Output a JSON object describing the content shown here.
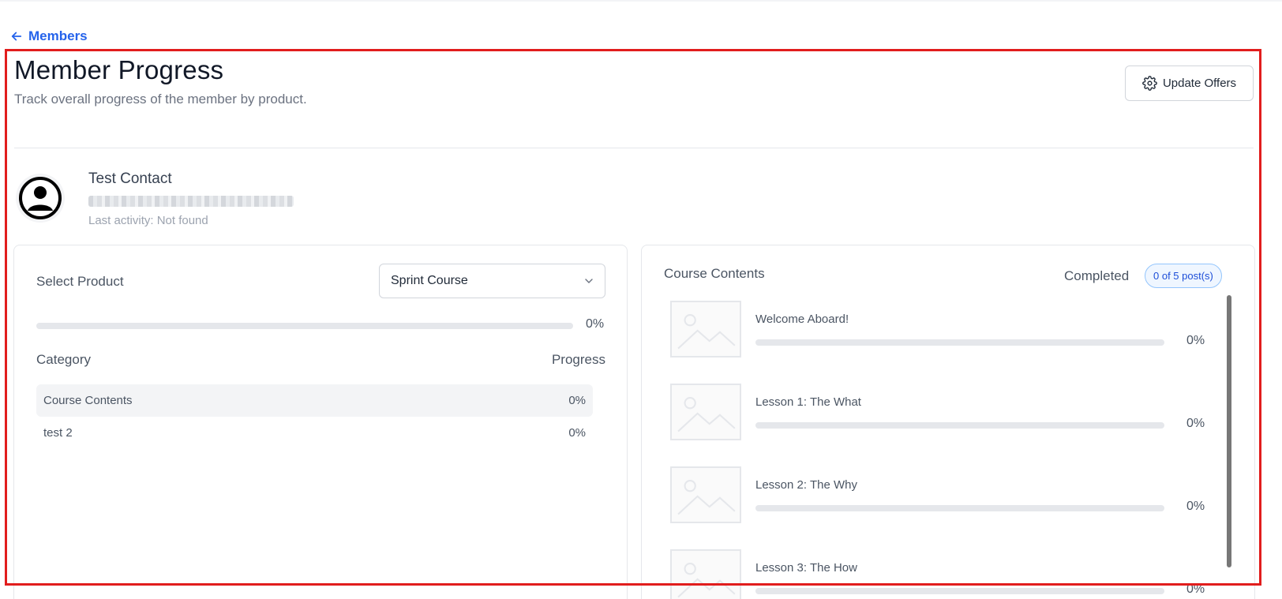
{
  "nav": {
    "back_label": "Members"
  },
  "header": {
    "title": "Member Progress",
    "subtitle": "Track overall progress of the member by product.",
    "update_offers_label": "Update Offers"
  },
  "contact": {
    "name": "Test Contact",
    "last_activity": "Last activity: Not found"
  },
  "product_panel": {
    "select_label": "Select Product",
    "selected_product": "Sprint Course",
    "overall_progress_percent": 0,
    "overall_progress_text": "0%",
    "category_header": "Category",
    "progress_header": "Progress",
    "categories": [
      {
        "name": "Course Contents",
        "progress": "0%",
        "active": true
      },
      {
        "name": "test 2",
        "progress": "0%",
        "active": false
      }
    ]
  },
  "contents_panel": {
    "title": "Course Contents",
    "completed_label": "Completed",
    "completed_badge": "0 of 5 post(s)",
    "lessons": [
      {
        "title": "Welcome Aboard!",
        "progress_percent": 0,
        "progress_text": "0%"
      },
      {
        "title": "Lesson 1: The What",
        "progress_percent": 0,
        "progress_text": "0%"
      },
      {
        "title": "Lesson 2: The Why",
        "progress_percent": 0,
        "progress_text": "0%"
      },
      {
        "title": "Lesson 3: The How",
        "progress_percent": 0,
        "progress_text": "0%"
      }
    ]
  },
  "colors": {
    "accent": "#2563eb",
    "highlight_border": "#e11d1d",
    "badge_bg": "#eff6ff",
    "badge_border": "#93c5fd"
  }
}
